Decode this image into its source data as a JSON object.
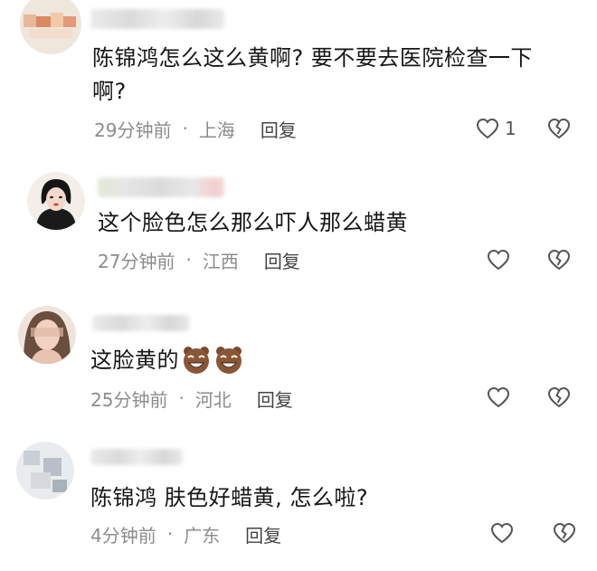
{
  "comments": [
    {
      "text": "陈锦鸿怎么这么黄啊? 要不要去医院检查一下啊?",
      "time": "29分钟前",
      "location": "上海",
      "reply_label": "回复",
      "like_count": "1"
    },
    {
      "text": "这个脸色怎么那么吓人那么蜡黄",
      "time": "27分钟前",
      "location": "江西",
      "reply_label": "回复"
    },
    {
      "text": "这脸黄的",
      "time": "25分钟前",
      "location": "河北",
      "reply_label": "回复"
    },
    {
      "text": "陈锦鸿 肤色好蜡黄, 怎么啦?",
      "time": "4分钟前",
      "location": "广东",
      "reply_label": "回复"
    }
  ],
  "meta_separator": "·",
  "icons": {
    "like": "heart-outline-icon",
    "dislike": "broken-heart-icon",
    "reaction_emoji": "laughing-face-emoji"
  },
  "colors": {
    "text": "#161616",
    "meta": "#8c8c8c",
    "icon": "#555555"
  }
}
